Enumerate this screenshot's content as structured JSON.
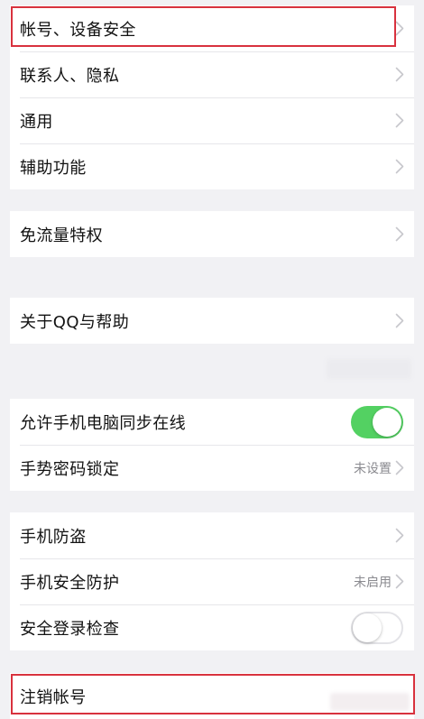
{
  "colors": {
    "background": "#f1f1f4",
    "cell_background": "#ffffff",
    "text_primary": "#121212",
    "text_secondary": "#8a8a8f",
    "toggle_on": "#53d162",
    "highlight_box": "#d8323e"
  },
  "settings": {
    "account_security": {
      "label": "帐号、设备安全",
      "icon": "chevron-right-icon",
      "highlighted": true
    },
    "contacts_privacy": {
      "label": "联系人、隐私",
      "icon": "chevron-right-icon"
    },
    "general": {
      "label": "通用",
      "icon": "chevron-right-icon"
    },
    "accessibility": {
      "label": "辅助功能",
      "icon": "chevron-right-icon"
    },
    "free_data": {
      "label": "免流量特权",
      "icon": "chevron-right-icon"
    },
    "about_help": {
      "label": "关于QQ与帮助",
      "icon": "chevron-right-icon"
    },
    "sync_online": {
      "label": "允许手机电脑同步在线",
      "toggle_on": true
    },
    "gesture_lock": {
      "label": "手势密码锁定",
      "value": "未设置",
      "icon": "chevron-right-icon"
    },
    "phone_antitheft": {
      "label": "手机防盗",
      "icon": "chevron-right-icon"
    },
    "phone_security": {
      "label": "手机安全防护",
      "value": "未启用",
      "icon": "chevron-right-icon"
    },
    "login_check": {
      "label": "安全登录检查",
      "toggle_on": false
    },
    "cancel_account": {
      "label": "注销帐号",
      "highlighted": true
    }
  }
}
